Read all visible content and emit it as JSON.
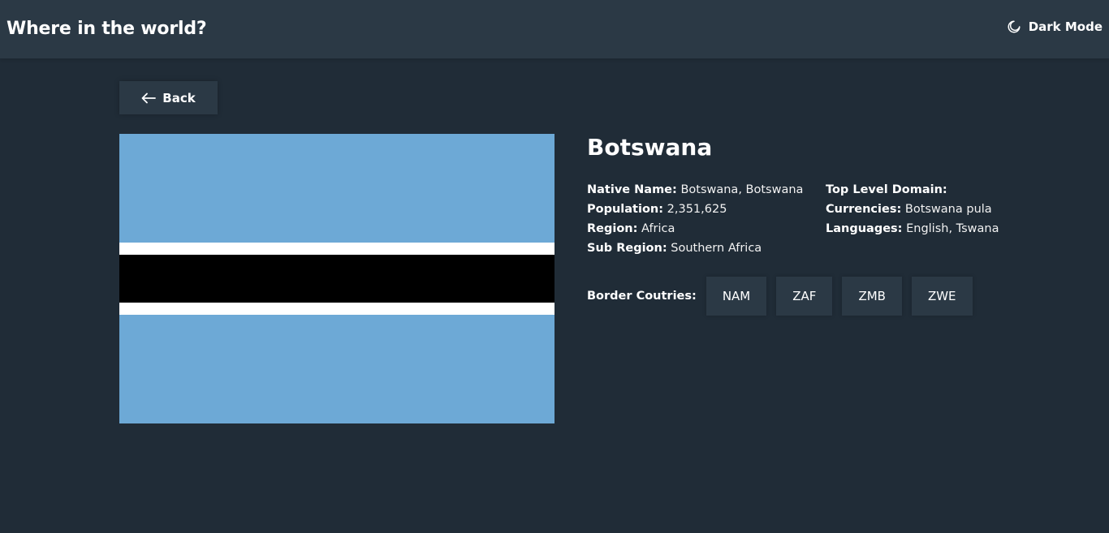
{
  "header": {
    "title": "Where in the world?",
    "theme_toggle_label": "Dark Mode",
    "theme_icon": "moon-icon"
  },
  "back": {
    "label": "Back",
    "icon": "arrow-left-icon"
  },
  "country": {
    "name": "Botswana",
    "flag": {
      "colors": [
        "#6da9d6",
        "#ffffff",
        "#000000"
      ]
    },
    "details_left": [
      {
        "label": "Native Name:",
        "value": "Botswana, Botswana"
      },
      {
        "label": "Population:",
        "value": "2,351,625"
      },
      {
        "label": "Region:",
        "value": "Africa"
      },
      {
        "label": "Sub Region:",
        "value": "Southern Africa"
      }
    ],
    "details_right": [
      {
        "label": "Top Level Domain:",
        "value": ""
      },
      {
        "label": "Currencies:",
        "value": "Botswana pula"
      },
      {
        "label": "Languages:",
        "value": "English, Tswana"
      }
    ],
    "borders_label": "Border Coutries:",
    "borders": [
      "NAM",
      "ZAF",
      "ZMB",
      "ZWE"
    ]
  },
  "colors": {
    "background": "#202c37",
    "element": "#2b3945",
    "text": "#ffffff"
  }
}
